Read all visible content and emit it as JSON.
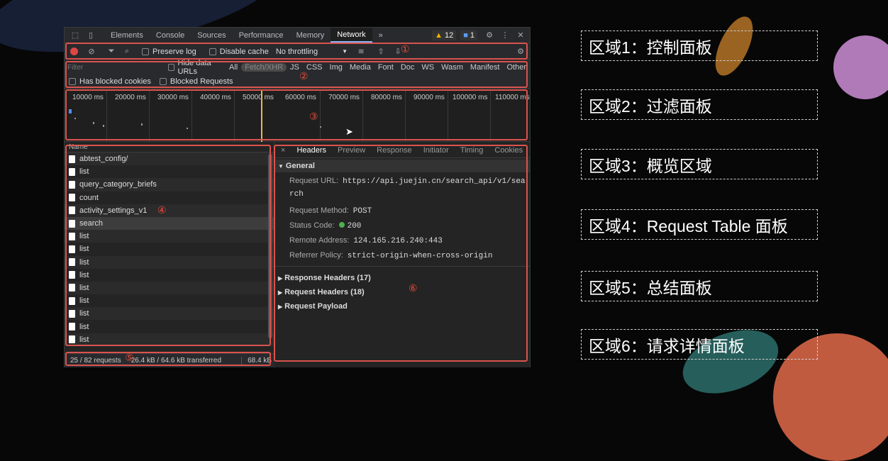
{
  "topbar": {
    "tabs": [
      "Elements",
      "Console",
      "Sources",
      "Performance",
      "Memory",
      "Network"
    ],
    "active_tab": "Network",
    "more": "»",
    "warnings": "12",
    "messages": "1"
  },
  "controls": {
    "preserve_log": "Preserve log",
    "disable_cache": "Disable cache",
    "throttling": "No throttling"
  },
  "filter": {
    "placeholder": "Filter",
    "hide_data_urls": "Hide data URLs",
    "types": [
      "All",
      "Fetch/XHR",
      "JS",
      "CSS",
      "Img",
      "Media",
      "Font",
      "Doc",
      "WS",
      "Wasm",
      "Manifest",
      "Other"
    ],
    "selected_type": "Fetch/XHR",
    "has_blocked_cookies": "Has blocked cookies",
    "blocked_requests": "Blocked Requests"
  },
  "overview": {
    "ticks": [
      "10000 ms",
      "20000 ms",
      "30000 ms",
      "40000 ms",
      "50000 ms",
      "60000 ms",
      "70000 ms",
      "80000 ms",
      "90000 ms",
      "100000 ms",
      "110000 ms"
    ]
  },
  "request_table": {
    "header": "Name",
    "rows": [
      "abtest_config/",
      "list",
      "query_category_briefs",
      "count",
      "activity_settings_v1",
      "search",
      "list",
      "list",
      "list",
      "list",
      "list",
      "list",
      "list",
      "list",
      "list"
    ],
    "selected": "search"
  },
  "summary": {
    "requests": "25 / 82 requests",
    "transferred": "26.4 kB / 64.6 kB transferred",
    "resources": "68.4 kB"
  },
  "detail": {
    "close": "×",
    "tabs": [
      "Headers",
      "Preview",
      "Response",
      "Initiator",
      "Timing",
      "Cookies"
    ],
    "active_tab": "Headers",
    "general": "General",
    "request_url_label": "Request URL:",
    "request_url": "https://api.juejin.cn/search_api/v1/search",
    "request_method_label": "Request Method:",
    "request_method": "POST",
    "status_code_label": "Status Code:",
    "status_code": "200",
    "remote_address_label": "Remote Address:",
    "remote_address": "124.165.216.240:443",
    "referrer_policy_label": "Referrer Policy:",
    "referrer_policy": "strict-origin-when-cross-origin",
    "response_headers": "Response Headers (17)",
    "request_headers": "Request Headers (18)",
    "request_payload": "Request Payload"
  },
  "region_markers": [
    "①",
    "②",
    "③",
    "④",
    "⑤",
    "⑥"
  ],
  "region_labels": [
    "区域1：控制面板",
    "区域2：过滤面板",
    "区域3：概览区域",
    "区域4：Request Table 面板",
    "区域5：总结面板",
    "区域6：请求详情面板"
  ],
  "colors": {
    "highlight": "#d9534f",
    "status_ok": "#4caf50",
    "record": "#e04545"
  }
}
